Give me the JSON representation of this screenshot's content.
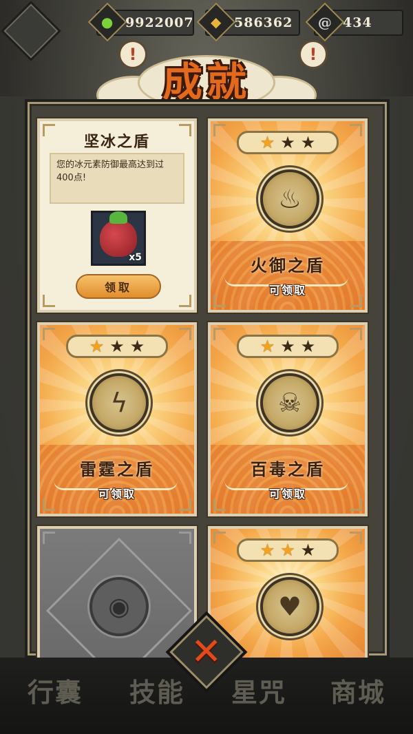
{
  "currencies": [
    {
      "icon": "green-gem-icon",
      "value": "9922007"
    },
    {
      "icon": "gold-coin-icon",
      "value": "586362"
    },
    {
      "icon": "silver-spiral-icon",
      "value": "434"
    }
  ],
  "header": {
    "title": "成就",
    "alert": "!"
  },
  "info_card": {
    "title": "坚冰之盾",
    "description": "您的冰元素防御最高达到过400点!",
    "reward_count": "x5",
    "claim_label": "领取"
  },
  "cards": [
    {
      "name": "火御之盾",
      "status": "可领取",
      "stars": 1,
      "icon": "flame-shield-icon"
    },
    {
      "name": "雷霆之盾",
      "status": "可领取",
      "stars": 1,
      "icon": "lightning-shield-icon"
    },
    {
      "name": "百毒之盾",
      "status": "可领取",
      "stars": 1,
      "icon": "skull-shield-icon"
    },
    {
      "name": "",
      "status": "",
      "stars": 2,
      "icon": "heart-icon"
    }
  ],
  "locked_card": {
    "icon": "eye-icon"
  },
  "bottom_nav": [
    "行囊",
    "技能",
    "星咒",
    "商城"
  ],
  "close_label": "✕",
  "colors": {
    "accent": "#e36a1c",
    "gold": "#f4a84a",
    "panel": "#46433b"
  }
}
